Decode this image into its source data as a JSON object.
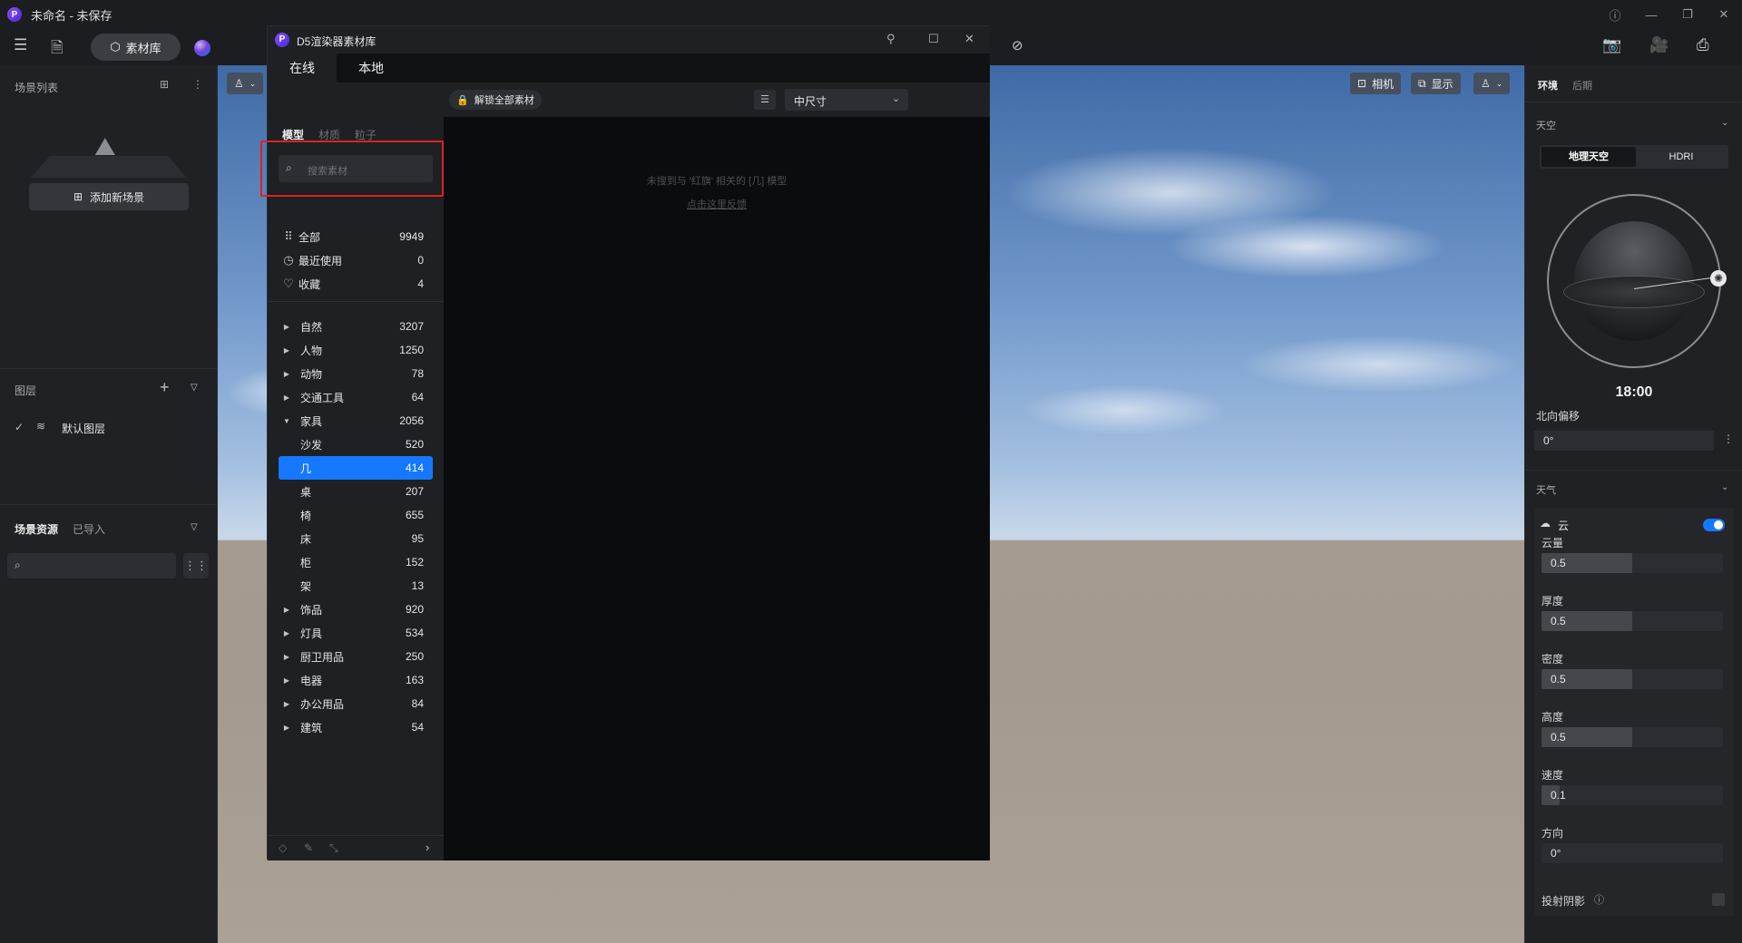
{
  "app": {
    "title": "未命名 - 未保存",
    "logo": "P"
  },
  "toolbar": {
    "asset_lib_label": "素材库"
  },
  "left_panel": {
    "scene_list_title": "场景列表",
    "add_scene_label": "添加新场景",
    "layers_title": "图层",
    "default_layer": "默认图层",
    "assets_title": "场景资源",
    "imported_tab": "已导入"
  },
  "viewport": {
    "camera_label": "相机",
    "display_label": "显示"
  },
  "right_panel": {
    "tab_env": "环境",
    "tab_post": "后期",
    "sky_title": "天空",
    "sky_opt_geo": "地理天空",
    "sky_opt_hdri": "HDRI",
    "time": "18:00",
    "north_offset_label": "北向偏移",
    "north_offset_value": "0°",
    "weather_title": "天气",
    "cloud_label": "云",
    "cloud_enabled": true,
    "params": [
      {
        "label": "云量",
        "value": "0.5",
        "level": 0.5
      },
      {
        "label": "厚度",
        "value": "0.5",
        "level": 0.5
      },
      {
        "label": "密度",
        "value": "0.5",
        "level": 0.5
      },
      {
        "label": "高度",
        "value": "0.5",
        "level": 0.5
      },
      {
        "label": "速度",
        "value": "0.1",
        "level": 0.1
      },
      {
        "label": "方向",
        "value": "0°",
        "level": 0
      }
    ],
    "shadow_label": "投射阴影"
  },
  "dialog": {
    "title": "D5渲染器素材库",
    "tab_online": "在线",
    "tab_local": "本地",
    "subtabs": [
      "模型",
      "材质",
      "粒子"
    ],
    "search_placeholder": "搜索素材",
    "unlock_label": "解锁全部素材",
    "size_select": "中尺寸",
    "empty_message": "未搜到与 '红旗' 相关的 [几] 模型",
    "feedback_link": "点击这里反馈",
    "quick": [
      {
        "name": "全部",
        "count": "9949",
        "icon": "grid-icon"
      },
      {
        "name": "最近使用",
        "count": "0",
        "icon": "clock-icon"
      },
      {
        "name": "收藏",
        "count": "4",
        "icon": "heart-icon"
      }
    ],
    "categories": [
      {
        "name": "自然",
        "count": "3207",
        "expanded": false
      },
      {
        "name": "人物",
        "count": "1250",
        "expanded": false
      },
      {
        "name": "动物",
        "count": "78",
        "expanded": false
      },
      {
        "name": "交通工具",
        "count": "64",
        "expanded": false
      },
      {
        "name": "家具",
        "count": "2056",
        "expanded": true
      },
      {
        "name": "沙发",
        "count": "520",
        "sub": true
      },
      {
        "name": "几",
        "count": "414",
        "sub": true,
        "selected": true
      },
      {
        "name": "桌",
        "count": "207",
        "sub": true
      },
      {
        "name": "椅",
        "count": "655",
        "sub": true
      },
      {
        "name": "床",
        "count": "95",
        "sub": true
      },
      {
        "name": "柜",
        "count": "152",
        "sub": true
      },
      {
        "name": "架",
        "count": "13",
        "sub": true
      },
      {
        "name": "饰品",
        "count": "920",
        "expanded": false
      },
      {
        "name": "灯具",
        "count": "534",
        "expanded": false
      },
      {
        "name": "厨卫用品",
        "count": "250",
        "expanded": false
      },
      {
        "name": "电器",
        "count": "163",
        "expanded": false
      },
      {
        "name": "办公用品",
        "count": "84",
        "expanded": false
      },
      {
        "name": "建筑",
        "count": "54",
        "expanded": false
      }
    ]
  },
  "colors": {
    "accent": "#1677ff",
    "highlight_box": "#e02020"
  }
}
